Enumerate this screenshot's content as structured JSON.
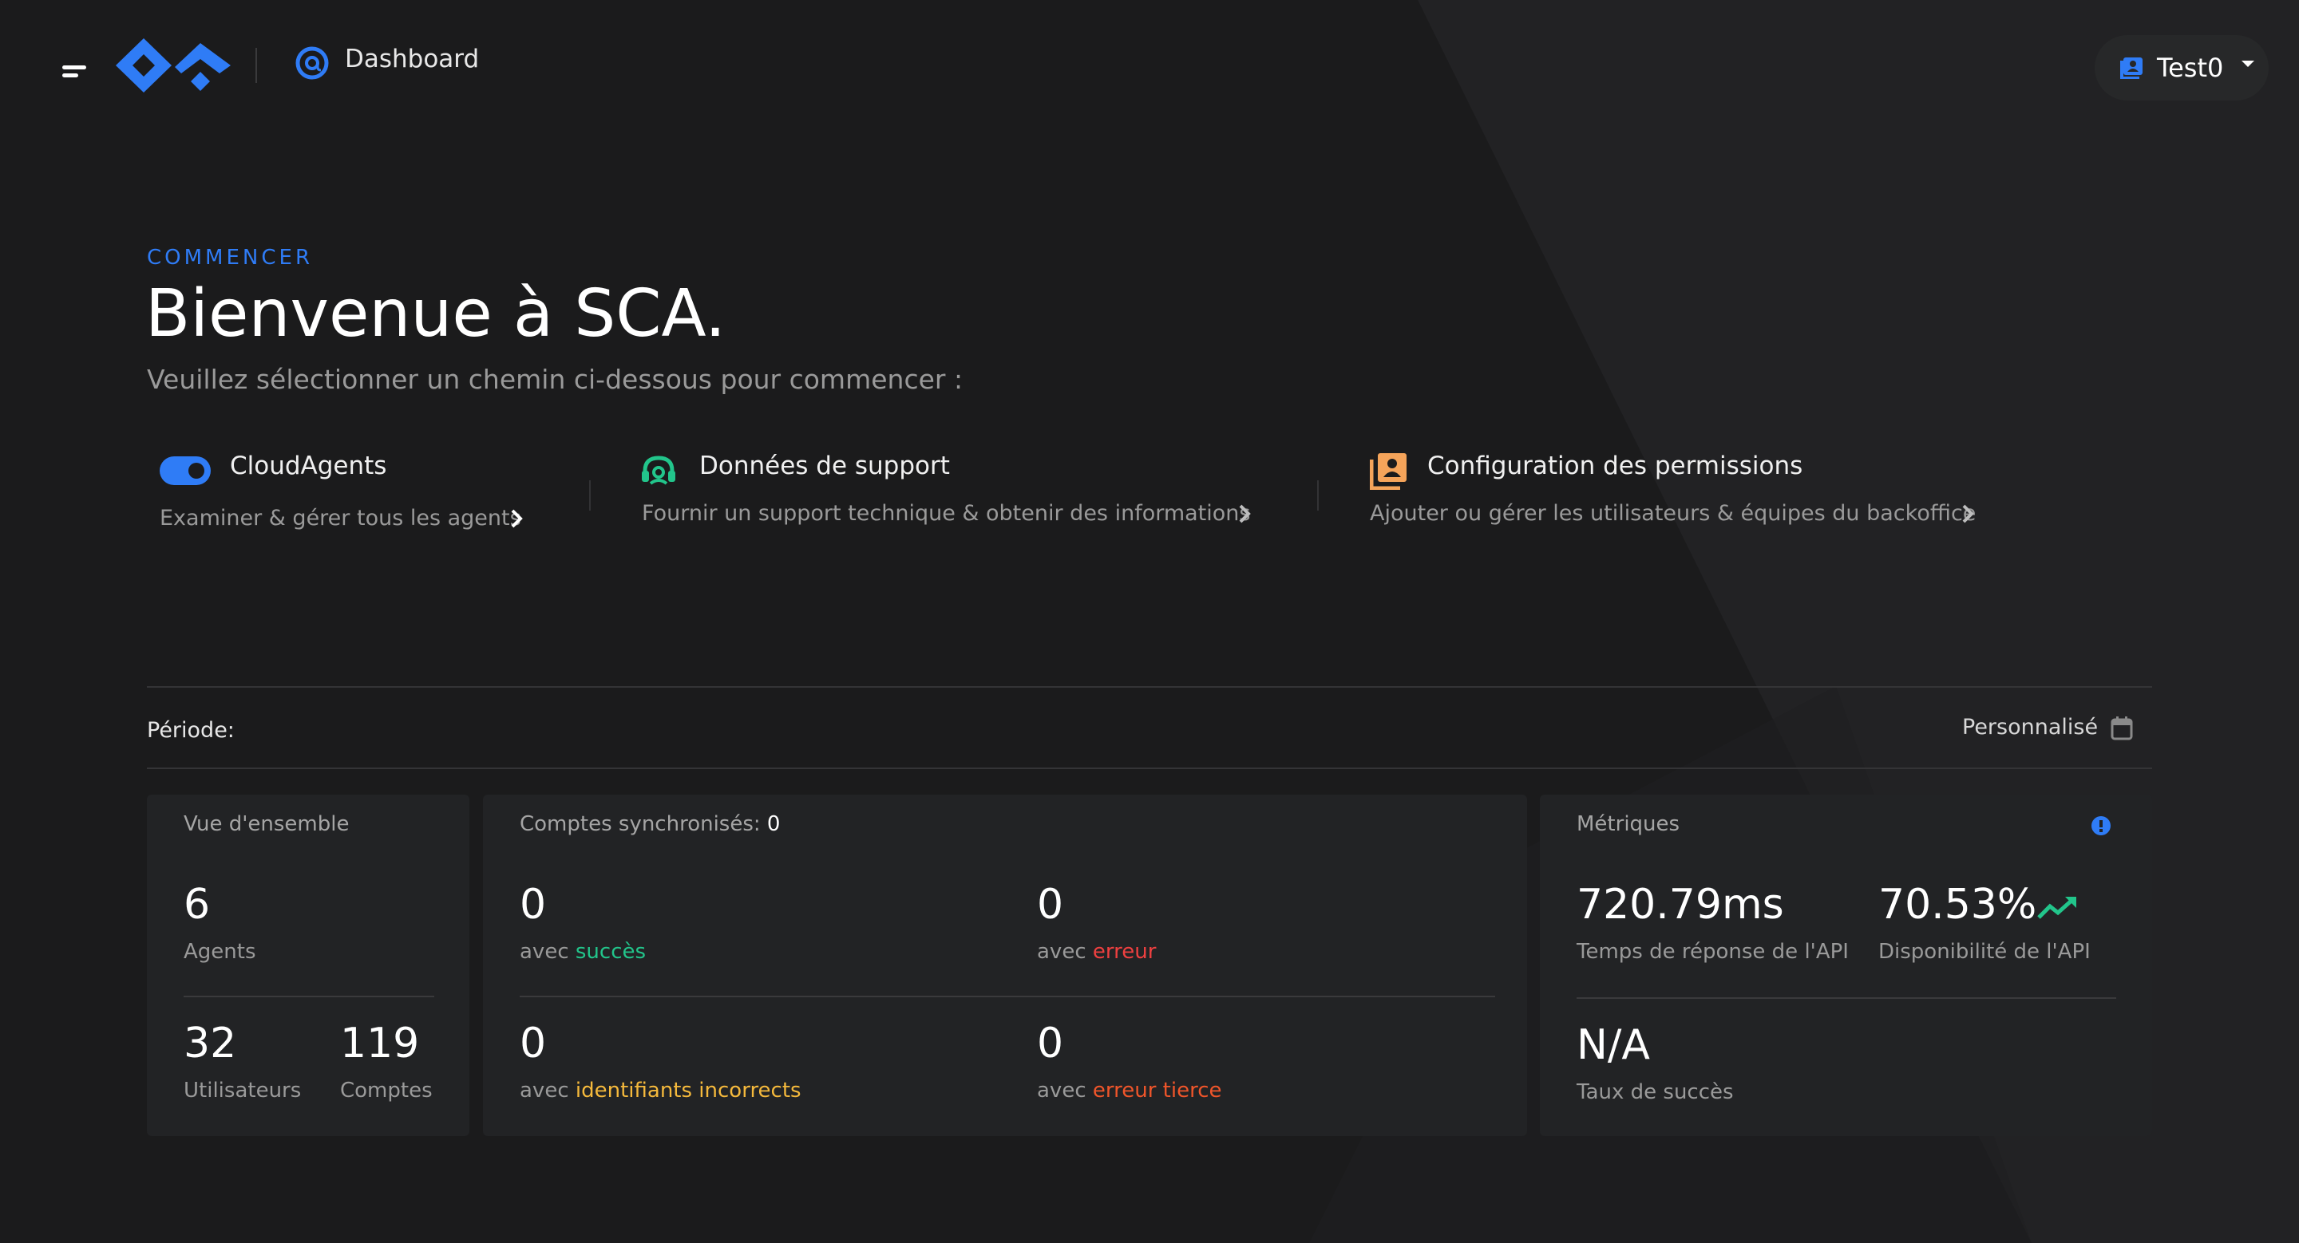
{
  "header": {
    "title": "Dashboard",
    "user_label": "Test0"
  },
  "intro": {
    "eyebrow": "COMMENCER",
    "headline": "Bienvenue à SCA.",
    "subline": "Veuillez sélectionner un chemin ci-dessous pour commencer :"
  },
  "paths": [
    {
      "title": "CloudAgents",
      "desc": "Examiner & gérer tous les agents",
      "icon": "toggle-icon",
      "color": "#2f7cf6"
    },
    {
      "title": "Données de support",
      "desc": "Fournir un support technique & obtenir des informations",
      "icon": "headset-icon",
      "color": "#22c58b"
    },
    {
      "title": "Configuration des permissions",
      "desc": "Ajouter ou gérer les utilisateurs & équipes du backoffice",
      "icon": "user-list-icon",
      "color": "#f5a45a"
    }
  ],
  "period": {
    "label": "Période:",
    "value": "Personnalisé"
  },
  "overview": {
    "title": "Vue d'ensemble",
    "agents_value": "6",
    "agents_label": "Agents",
    "users_value": "32",
    "users_label": "Utilisateurs",
    "accounts_value": "119",
    "accounts_label": "Comptes"
  },
  "sync": {
    "title": "Comptes synchronisés:",
    "count": "0",
    "prefix": "avec",
    "items": [
      {
        "value": "0",
        "status": "succès",
        "color": "#22c58b"
      },
      {
        "value": "0",
        "status": "erreur",
        "color": "#ef4040"
      },
      {
        "value": "0",
        "status": "identifiants incorrects",
        "color": "#f5b93c"
      },
      {
        "value": "0",
        "status": "erreur tierce",
        "color": "#f0552a"
      }
    ]
  },
  "metrics": {
    "title": "Métriques",
    "response_value": "720.79ms",
    "response_label": "Temps de réponse de l'API",
    "uptime_value": "70.53%",
    "uptime_label": "Disponibilité de l'API",
    "success_value": "N/A",
    "success_label": "Taux de succès"
  },
  "colors": {
    "accent": "#2f7cf6",
    "background": "#1b1b1c",
    "card": "#222325",
    "trend_up": "#22c58b",
    "info": "#2f7cf6"
  }
}
